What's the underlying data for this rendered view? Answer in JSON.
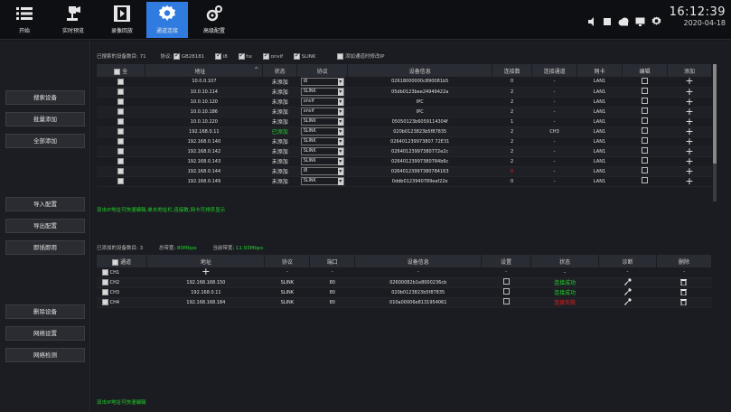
{
  "nav": {
    "items": [
      {
        "label": "开始",
        "icon": "menu-icon"
      },
      {
        "label": "实时预览",
        "icon": "camera-icon"
      },
      {
        "label": "录像回放",
        "icon": "playback-icon"
      },
      {
        "label": "通道连接",
        "icon": "settings-gear-icon",
        "active": true
      },
      {
        "label": "高级配置",
        "icon": "advanced-config-icon"
      }
    ]
  },
  "clock": {
    "time": "16:12:39",
    "date": "2020-04-18"
  },
  "left_buttons": {
    "search": "搜索设备",
    "batch_add": "批量添加",
    "add_all": "全部添加",
    "import": "导入配置",
    "export": "导出配置",
    "instant": "即插即用",
    "delete": "删除设备",
    "net_settings": "网络设置",
    "net_test": "网络检测"
  },
  "search_panel": {
    "found_label": "已搜索的设备数目:",
    "found_count": "71",
    "protocol_label": "协议:",
    "protocols": [
      {
        "name": "GB28181",
        "checked": true
      },
      {
        "name": "i8",
        "checked": true
      },
      {
        "name": "hx",
        "checked": true
      },
      {
        "name": "onvif",
        "checked": true
      },
      {
        "name": "SLINK",
        "checked": true
      }
    ],
    "modify_ip_label": "添加通道时修改IP",
    "columns": {
      "all": "全",
      "address": "地址",
      "status": "状态",
      "protocol": "协议",
      "device_info": "设备信息",
      "connections": "连接数",
      "connected_channel": "连接通道",
      "nic": "网卡",
      "edit": "编辑",
      "add": "添加"
    },
    "rows": [
      {
        "address": "10.0.0.107",
        "status": "未添加",
        "protocol": "i8",
        "info": "02618000000c890081b5",
        "conn": "0",
        "channel": "-",
        "nic": "LAN1"
      },
      {
        "address": "10.0.10.114",
        "status": "未添加",
        "protocol": "SLINK",
        "info": "05db0123bee24949422a",
        "conn": "2",
        "channel": "-",
        "nic": "LAN1"
      },
      {
        "address": "10.0.10.120",
        "status": "未添加",
        "protocol": "onvif",
        "info": "IPC",
        "conn": "2",
        "channel": "-",
        "nic": "LAN1"
      },
      {
        "address": "10.0.10.186",
        "status": "未添加",
        "protocol": "onvif",
        "info": "IPC",
        "conn": "2",
        "channel": "-",
        "nic": "LAN1"
      },
      {
        "address": "10.0.10.220",
        "status": "未添加",
        "protocol": "SLINK",
        "info": "05050123b6059114304f",
        "conn": "1",
        "channel": "-",
        "nic": "LAN1"
      },
      {
        "address": "192.168.0.11",
        "status": "已添加",
        "protocol": "SLINK",
        "info": "020b0123823b5f87835",
        "conn": "2",
        "channel": "CH3",
        "nic": "LAN1"
      },
      {
        "address": "192.168.0.140",
        "status": "未添加",
        "protocol": "SLINK",
        "info": "026401239973807 72E31",
        "conn": "2",
        "channel": "-",
        "nic": "LAN1"
      },
      {
        "address": "192.168.0.142",
        "status": "未添加",
        "protocol": "SLINK",
        "info": "02640123997380772e2c",
        "conn": "2",
        "channel": "-",
        "nic": "LAN1"
      },
      {
        "address": "192.168.0.143",
        "status": "未添加",
        "protocol": "SLINK",
        "info": "02640123997380784b6c",
        "conn": "2",
        "channel": "-",
        "nic": "LAN1"
      },
      {
        "address": "192.168.0.144",
        "status": "未添加",
        "protocol": "i8",
        "info": "02640123997380784163",
        "conn": "0",
        "channel": "-",
        "nic": "LAN1"
      },
      {
        "address": "192.168.0.149",
        "status": "未添加",
        "protocol": "SLINK",
        "info": "0ddb0123940789eaf22e",
        "conn": "0",
        "channel": "-",
        "nic": "LAN1"
      }
    ],
    "hint": "双击IP地址可快速编辑,单击地址栏,连接数,网卡可排序显示"
  },
  "added_panel": {
    "added_label": "已添加的设备数目:",
    "added_count": "3",
    "total_bw_label": "总带宽:",
    "total_bw": "80Mbps",
    "current_bw_label": "当前带宽:",
    "current_bw": "11.93Mbps",
    "columns": {
      "channel": "通道",
      "address": "地址",
      "protocol": "协议",
      "port": "端口",
      "device_info": "设备信息",
      "settings": "设置",
      "status": "状态",
      "diagnose": "诊断",
      "delete": "删除"
    },
    "rows": [
      {
        "ch": "CH1",
        "address": "+",
        "protocol": "-",
        "port": "-",
        "info": "-",
        "settings": "-",
        "status": "-",
        "status_kind": "none",
        "diag": "-",
        "del": "-"
      },
      {
        "ch": "CH2",
        "address": "192.168.168.150",
        "protocol": "SLINK",
        "port": "80",
        "info": "02600082b1e8000236cb",
        "settings": "edit",
        "status": "连接成功",
        "status_kind": "ok",
        "diag": "wrench",
        "del": "trash"
      },
      {
        "ch": "CH3",
        "address": "192.168.0.11",
        "protocol": "SLINK",
        "port": "80",
        "info": "020b0123823b5f87835",
        "settings": "edit",
        "status": "连接成功",
        "status_kind": "ok",
        "diag": "wrench",
        "del": "trash"
      },
      {
        "ch": "CH4",
        "address": "192.168.168.184",
        "protocol": "SLINK",
        "port": "80",
        "info": "010a00006e8131954061",
        "settings": "edit",
        "status": "连接失败",
        "status_kind": "fail",
        "diag": "wrench",
        "del": "trash"
      }
    ],
    "hint": "双击IP地址可快速编辑"
  }
}
